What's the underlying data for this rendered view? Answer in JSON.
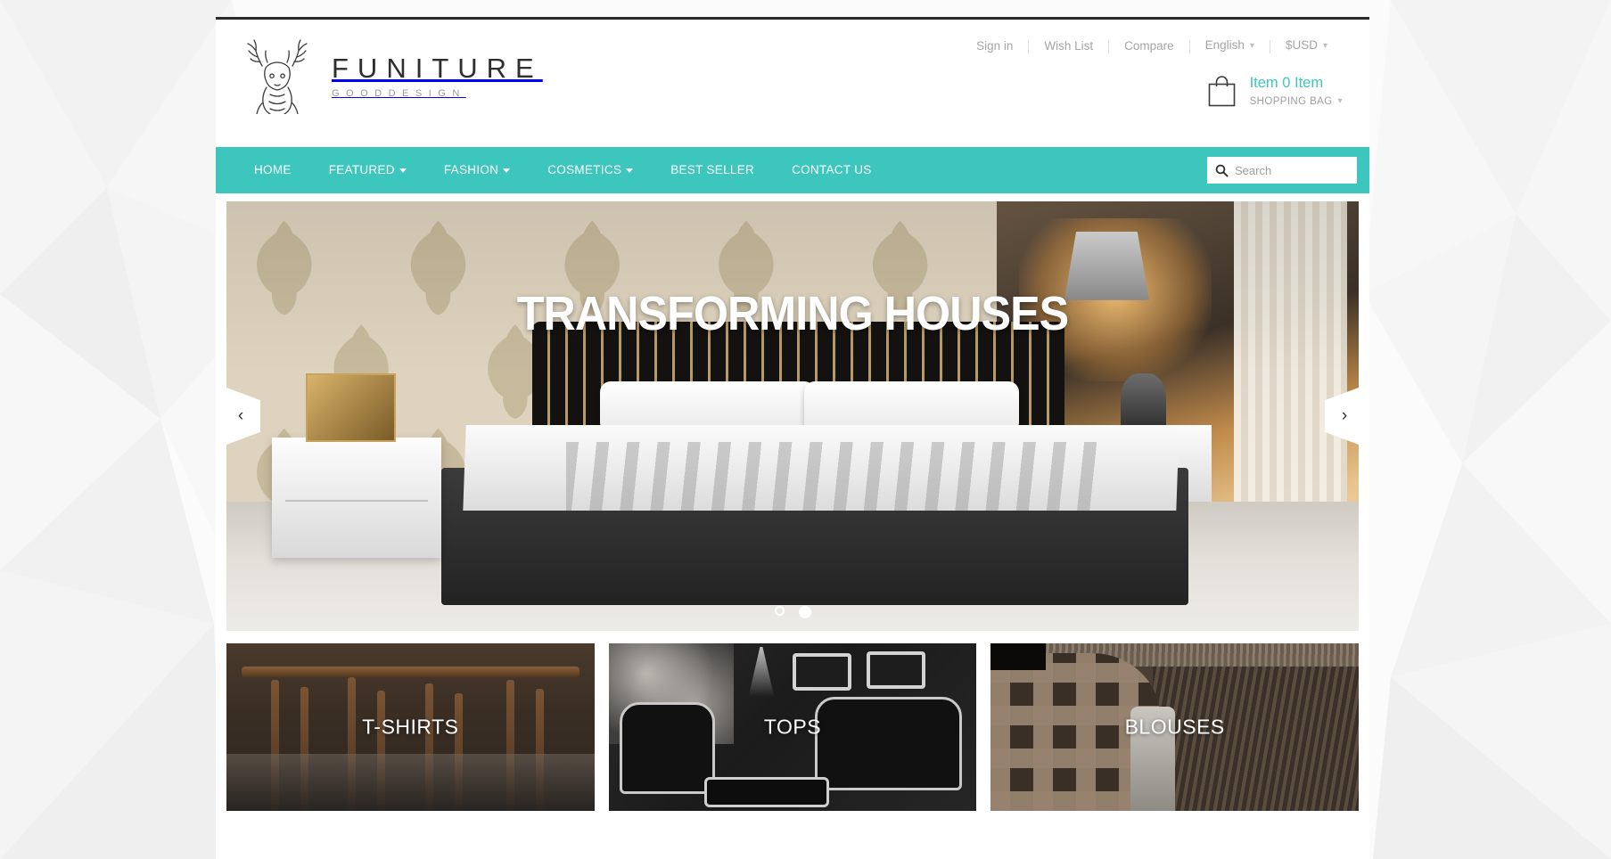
{
  "theme": {
    "accent": "#3dc6be",
    "dark": "#2b2b2b",
    "muted": "#a5a5a5"
  },
  "header": {
    "logo": {
      "icon": "deer-head-icon",
      "title": "FUNITURE",
      "subtitle": "GOODDESIGN"
    },
    "top_links": [
      {
        "label": "Sign in"
      },
      {
        "label": "Wish List"
      },
      {
        "label": "Compare"
      }
    ],
    "language": {
      "label": "English",
      "icon": "chevron-down-icon"
    },
    "currency": {
      "label": "$USD",
      "icon": "chevron-down-icon"
    },
    "cart": {
      "icon": "shopping-bag-icon",
      "count_text": "Item 0 Item",
      "label": "SHOPPING BAG",
      "caret": "chevron-down-icon"
    }
  },
  "nav": {
    "items": [
      {
        "label": "HOME",
        "has_dropdown": false
      },
      {
        "label": "FEATURED",
        "has_dropdown": true
      },
      {
        "label": "FASHION",
        "has_dropdown": true
      },
      {
        "label": "COSMETICS",
        "has_dropdown": true
      },
      {
        "label": "BEST SELLER",
        "has_dropdown": false
      },
      {
        "label": "CONTACT US",
        "has_dropdown": false
      }
    ],
    "search": {
      "icon": "search-icon",
      "placeholder": "Search",
      "value": ""
    }
  },
  "hero": {
    "caption": "TRANSFORMING HOUSES",
    "prev_icon": "chevron-left-icon",
    "next_icon": "chevron-right-icon",
    "slides": [
      {
        "index": 1,
        "active": false
      },
      {
        "index": 2,
        "active": true
      }
    ]
  },
  "categories": [
    {
      "label": "T-SHIRTS",
      "art": "wooden-chairs"
    },
    {
      "label": "TOPS",
      "art": "baroque-living-room"
    },
    {
      "label": "BLOUSES",
      "art": "woven-leather"
    }
  ]
}
